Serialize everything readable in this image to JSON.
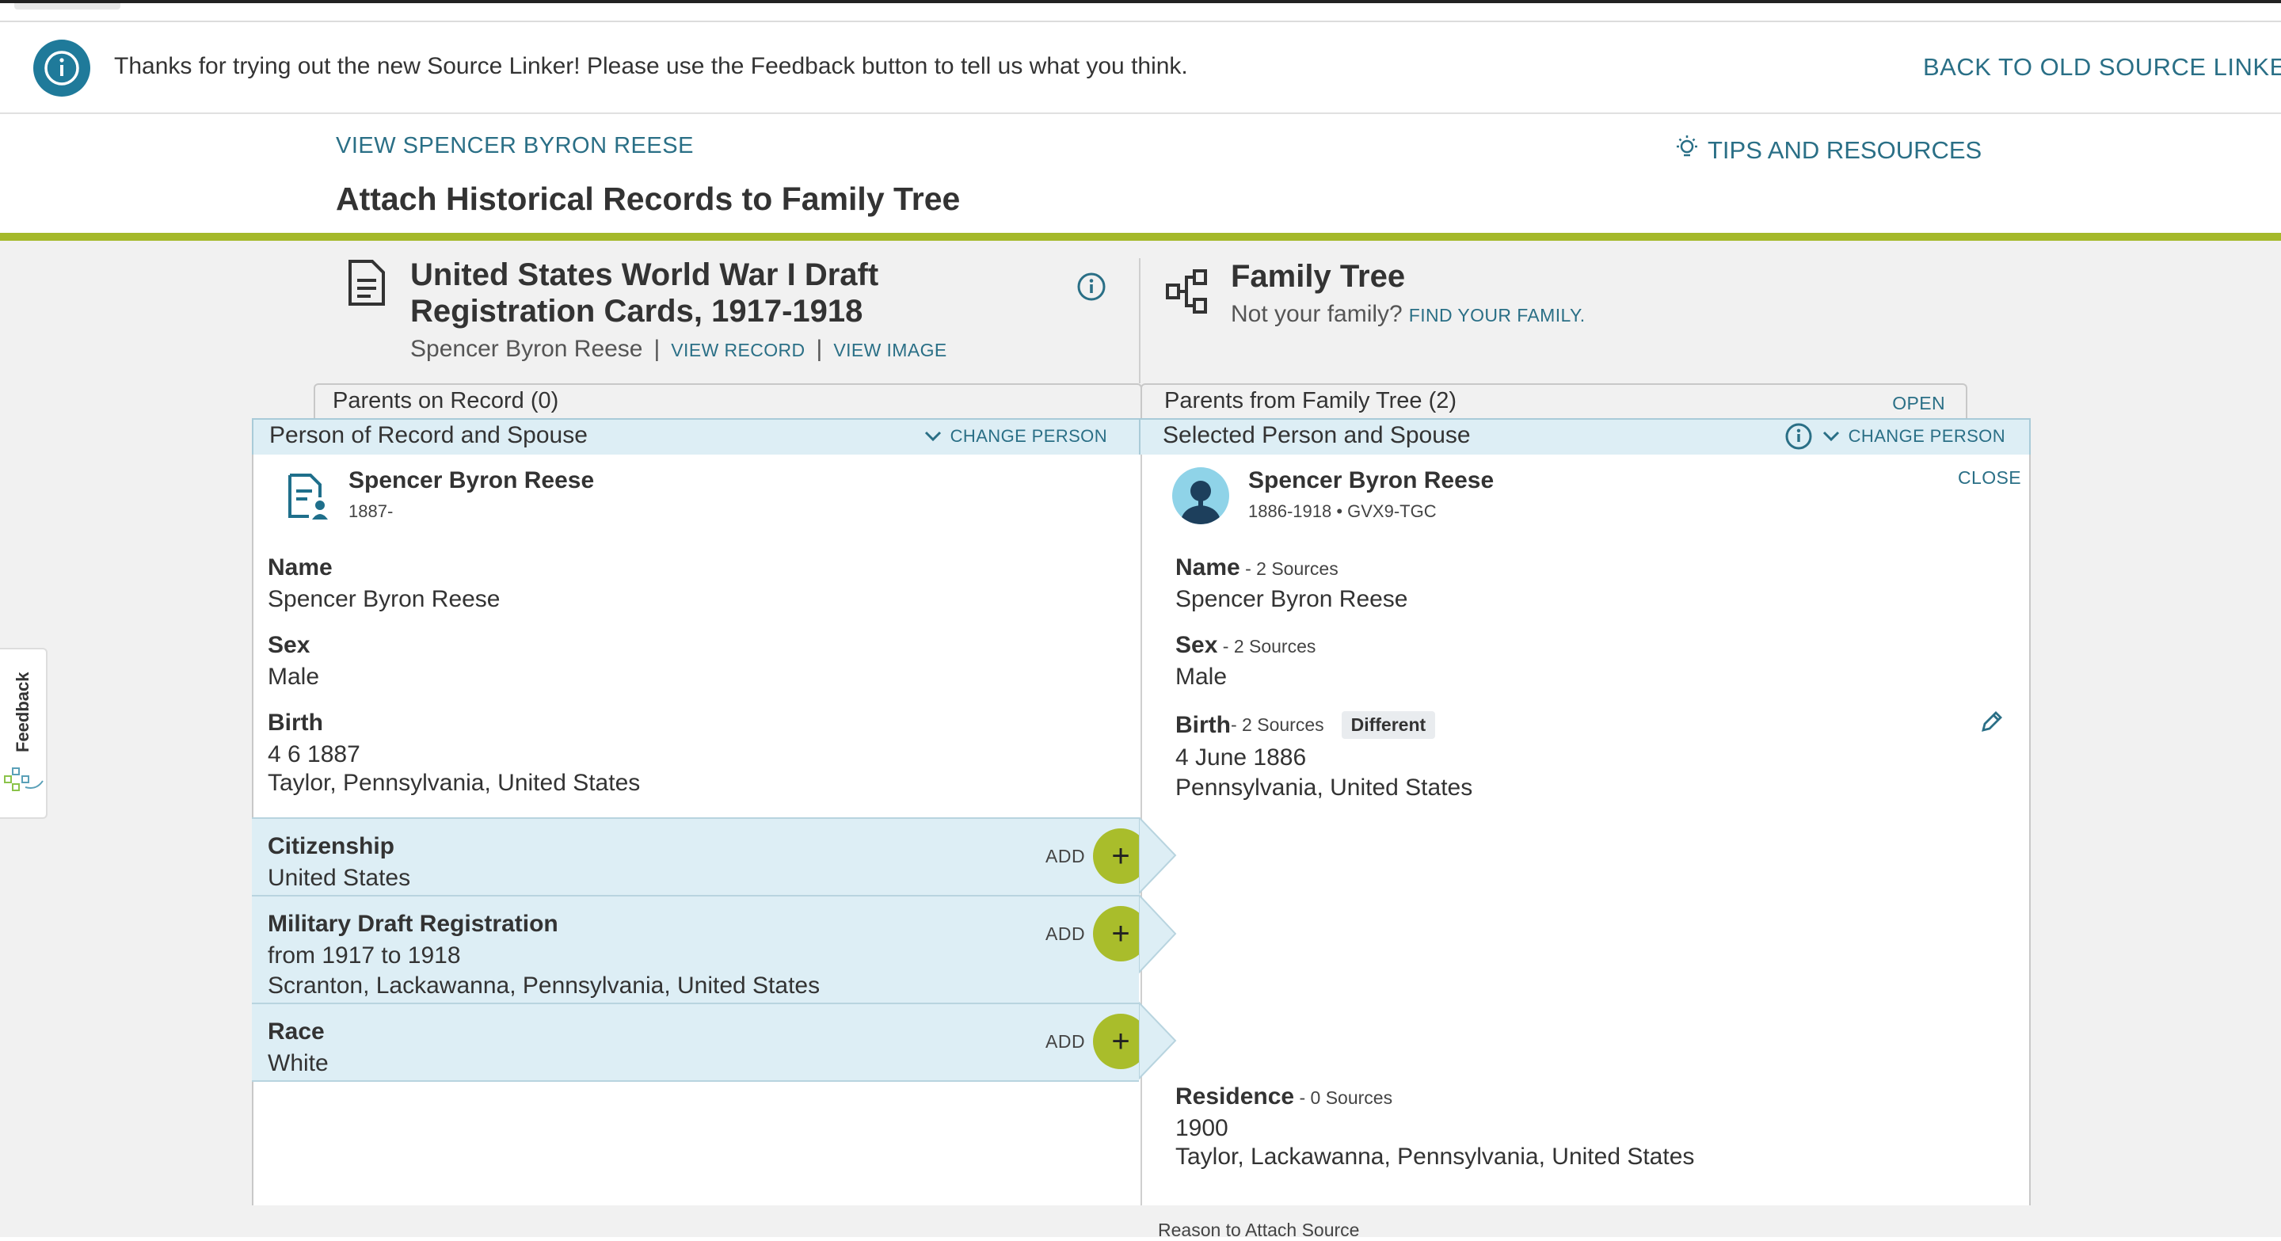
{
  "banner": {
    "message": "Thanks for trying out the new Source Linker! Please use the Feedback button to tell us what you think.",
    "back_link": "BACK TO OLD SOURCE LINKER",
    "icon": "info-icon"
  },
  "header": {
    "view_person": "VIEW SPENCER BYRON REESE",
    "tips": "TIPS AND RESOURCES",
    "title": "Attach Historical Records to Family Tree"
  },
  "record": {
    "title_line1": "United States World War I Draft",
    "title_line2": "Registration Cards, 1917-1918",
    "person": "Spencer Byron Reese",
    "sep": "|",
    "view_record": "VIEW RECORD",
    "view_image": "VIEW IMAGE"
  },
  "tree": {
    "title": "Family Tree",
    "not_family": "Not your family?",
    "find_family": "FIND YOUR FAMILY."
  },
  "tabs": {
    "left": "Parents on Record (0)",
    "right": "Parents from Family Tree (2)",
    "open": "OPEN"
  },
  "sections": {
    "left": "Person of Record and Spouse",
    "right": "Selected Person and Spouse",
    "change_person": "CHANGE PERSON"
  },
  "left_person": {
    "name": "Spencer Byron Reese",
    "dates": "1887-",
    "fields": {
      "name_label": "Name",
      "name_value": "Spencer Byron Reese",
      "sex_label": "Sex",
      "sex_value": "Male",
      "birth_label": "Birth",
      "birth_date": "4 6 1887",
      "birth_place": "Taylor, Pennsylvania, United States"
    },
    "add_rows": [
      {
        "label": "Citizenship",
        "line1": "United States",
        "line2": ""
      },
      {
        "label": "Military Draft Registration",
        "line1": "from 1917 to 1918",
        "line2": "Scranton, Lackawanna, Pennsylvania, United States"
      },
      {
        "label": "Race",
        "line1": "White",
        "line2": ""
      }
    ],
    "add_text": "ADD",
    "add_symbol": "+"
  },
  "right_person": {
    "name": "Spencer Byron Reese",
    "dates": "1886-1918 • GVX9-TGC",
    "close": "CLOSE",
    "fields": {
      "name_label": "Name",
      "name_src": " - 2 Sources",
      "name_value": "Spencer Byron Reese",
      "sex_label": "Sex",
      "sex_src": " - 2 Sources",
      "sex_value": "Male",
      "birth_label": "Birth",
      "birth_src": " - 2 Sources",
      "birth_badge": "Different",
      "birth_date": "4 June 1886",
      "birth_place": "Pennsylvania, United States",
      "res_label": "Residence",
      "res_src": " - 0 Sources",
      "res_date": "1900",
      "res_place": "Taylor, Lackawanna, Pennsylvania, United States"
    }
  },
  "feedback": "Feedback",
  "reason": "Reason to Attach Source",
  "colors": {
    "teal": "#2a6f86",
    "green": "#a5b92a",
    "add_button": "#a9bd2b",
    "section_bg": "#ddeef5"
  }
}
